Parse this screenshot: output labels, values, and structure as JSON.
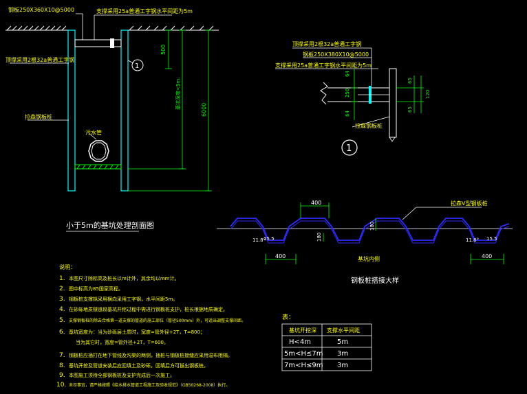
{
  "colors": {
    "background": "#000000",
    "outline": "#ffffff",
    "dimension": "#00ff00",
    "annotation": "#ffff00",
    "profile": "#2b2bff",
    "pipe": "#00ffff"
  },
  "section": {
    "label_top_beam": "钢板250X360X10@5000",
    "label_brace": "支撑采用25a普通工字钢水平间距为5m",
    "label_left_beam": "顶撑采用2根32a普通工字钢",
    "label_pile": "拉森钢板桩",
    "label_pipe": "污水管",
    "dim_500": "500",
    "dim_depth": "基坑深度<5m",
    "dim_6000": "6000",
    "circle_mark": "1",
    "title": "小于5m的基坑处理剖面图"
  },
  "detail": {
    "label_beam": "顶撑采用2根32a普通工字钢",
    "label_plate": "钢板250X380X10@5000",
    "label_brace": "支撑采用25a普通工字钢水平间距为5m",
    "label_pile": "拉森钢板桩",
    "dim_64_top": "64",
    "dim_250": "250",
    "dim_64_bottom": "64",
    "dim_65_top": "65",
    "dim_120": "120",
    "dim_65_bottom": "65",
    "mark": "1"
  },
  "pile": {
    "dim_400_top": "400",
    "dim_180_right": "180",
    "dim_180_left": "180",
    "dim_400_left": "400",
    "dim_400_right": "400",
    "label_outside": "拉森V型钢板桩",
    "label_inside": "基坑内侧",
    "angle_left": "11.8°",
    "value_left": "15.5",
    "angle_right": "11.8°",
    "value_right": "15.5",
    "title": "钢板桩搭接大样"
  },
  "notes": {
    "heading": "说明：",
    "items": [
      {
        "num": "1.",
        "text": "本图尺寸除标高及桩长以m计外，其余均以mm计。"
      },
      {
        "num": "2.",
        "text": "图中标高为85国家高程。"
      },
      {
        "num": "3.",
        "text": "钢板桩支撑拟采用横向采用工字钢，水平间距5m。"
      },
      {
        "num": "4.",
        "text": "在砂砾地质隧道段基坑开挖过程中需进行钢板桩支护，桩长根据地质确定。"
      },
      {
        "num": "5.",
        "text": "支撑钢板桩的除去合格第一道支撑的管道的施工部位（管径500mm）外，可适当调整支撑间距。"
      },
      {
        "num": "6.",
        "text": "基坑宽度为：当为砂砾层土质时，宽度=管外径+2T，T=800；"
      },
      {
        "num": "",
        "text": "当为其它时，宽度=管外径+2T，T=600。"
      },
      {
        "num": "7.",
        "text": "钢板桩应插打在地下管线及沟渠的两侧，插桩与钢板桩接缝应采用湿布阻隔。"
      },
      {
        "num": "8.",
        "text": "基坑开挖及管道安装后应回填土及砂砾，回填后方可拔出钢板桩。"
      },
      {
        "num": "9.",
        "text": "本图施工须待全部钢板桩及支护完成后一次施工。"
      },
      {
        "num": "10.",
        "text": "未尽事宜，请严格按照《给水排水管道工程施工及验收规范》（GB50268-2008）执行。"
      }
    ]
  },
  "table": {
    "caption": "表：",
    "headers": [
      "基坑开挖深",
      "支撑水平间距"
    ],
    "rows": [
      [
        "H<4m",
        "5m"
      ],
      [
        "5m<H≤7m",
        "3m"
      ],
      [
        "7m<H≤9m",
        "3m"
      ]
    ]
  }
}
